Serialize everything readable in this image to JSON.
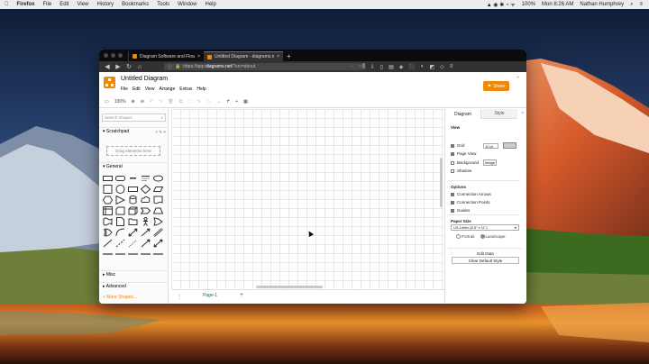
{
  "menubar": {
    "app": "Firefox",
    "items": [
      "File",
      "Edit",
      "View",
      "History",
      "Bookmarks",
      "Tools",
      "Window",
      "Help"
    ],
    "battery": "100%",
    "clock": "Mon 8:26 AM",
    "user": "Nathan Humphrey"
  },
  "browser": {
    "tabs": [
      {
        "title": "Diagram Software and Flowcha..."
      },
      {
        "title": "Untitled Diagram - diagrams.net"
      }
    ],
    "new_tab": "+",
    "url_prefix": "https://app.",
    "url_domain": "diagrams.net",
    "url_suffix": "/?src=about"
  },
  "app": {
    "title": "Untitled Diagram",
    "menus": [
      "File",
      "Edit",
      "View",
      "Arrange",
      "Extras",
      "Help"
    ],
    "share_label": "Share",
    "collapse": "⌃"
  },
  "toolbar": {
    "zoom": "100%",
    "items": [
      "▭",
      "100%",
      "⊕",
      "⊖",
      "↶",
      "↷",
      "🗑",
      "⧉",
      "⬚",
      "✎",
      "▭",
      "→",
      "↱",
      "+",
      "▦"
    ]
  },
  "sidebar": {
    "search_placeholder": "Search Shapes",
    "scratchpad": "Scratchpad",
    "scratch_icons": "+ ✎ ×",
    "drop_label": "Drag elements here",
    "general": "General",
    "misc": "Misc",
    "advanced": "Advanced",
    "more_shapes": "+ More Shapes..."
  },
  "footer": {
    "page_tab": "Page-1",
    "add_page": "+",
    "page_menu": "⋮"
  },
  "format": {
    "tab_diagram": "Diagram",
    "tab_style": "Style",
    "view_label": "View",
    "grid": "Grid",
    "grid_size": "10 pt",
    "page_view": "Page View",
    "background": "Background",
    "image_btn": "Image",
    "shadow": "Shadow",
    "options_label": "Options",
    "connection_arrows": "Connection Arrows",
    "connection_points": "Connection Points",
    "guides": "Guides",
    "paper_size_label": "Paper Size",
    "paper_size": "US-Letter (8,5\" x 11\")",
    "portrait": "Portrait",
    "landscape": "Landscape",
    "edit_data": "Edit Data",
    "clear_default": "Clear Default Style",
    "grid_color": "#cccccc"
  }
}
